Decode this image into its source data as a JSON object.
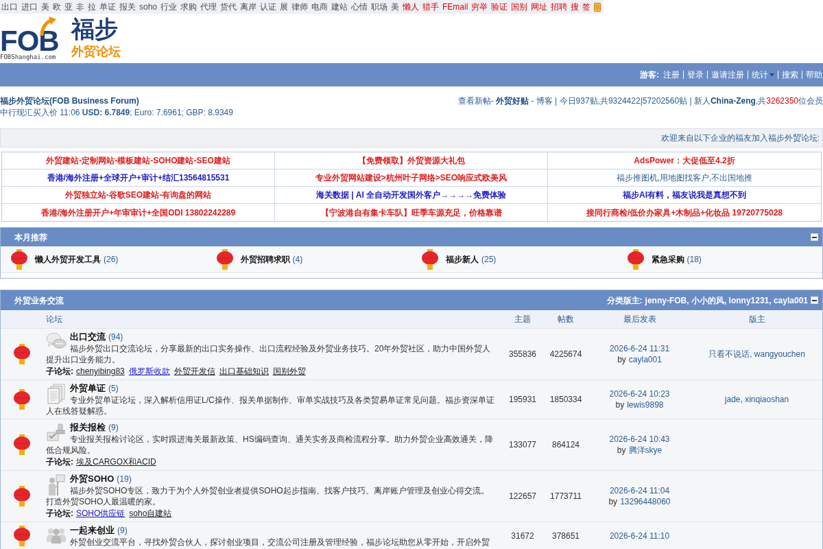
{
  "top_nav": [
    {
      "label": "出口",
      "hot": false
    },
    {
      "label": "进口",
      "hot": false
    },
    {
      "label": "美",
      "hot": false
    },
    {
      "label": "欧",
      "hot": false
    },
    {
      "label": "亚",
      "hot": false
    },
    {
      "label": "非",
      "hot": false
    },
    {
      "label": "拉",
      "hot": false
    },
    {
      "label": "单证",
      "hot": false
    },
    {
      "label": "报关",
      "hot": false
    },
    {
      "label": "soho",
      "hot": false
    },
    {
      "label": "行业",
      "hot": false
    },
    {
      "label": "求购",
      "hot": false
    },
    {
      "label": "代理",
      "hot": false
    },
    {
      "label": "货代",
      "hot": false
    },
    {
      "label": "离岸",
      "hot": false
    },
    {
      "label": "认证",
      "hot": false
    },
    {
      "label": "展",
      "hot": false
    },
    {
      "label": "律师",
      "hot": false
    },
    {
      "label": "电商",
      "hot": false
    },
    {
      "label": "建站",
      "hot": false
    },
    {
      "label": "心情",
      "hot": false
    },
    {
      "label": "职场",
      "hot": false
    },
    {
      "label": "美",
      "hot": false
    },
    {
      "label": "懒人",
      "hot": true
    },
    {
      "label": "猎手",
      "hot": true
    },
    {
      "label": "FEmail",
      "hot": true
    },
    {
      "label": "穷举",
      "hot": true
    },
    {
      "label": "验证",
      "hot": true
    },
    {
      "label": "国别",
      "hot": true
    },
    {
      "label": "网址",
      "hot": true
    },
    {
      "label": "招聘",
      "hot": true
    },
    {
      "label": "搜",
      "hot": true
    },
    {
      "label": "签",
      "hot": true
    }
  ],
  "logo": {
    "wordmark": "FOB",
    "domain": "FOBShanghai.com",
    "name": "福步",
    "tagline": "外贸论坛"
  },
  "user_bar": {
    "label": "游客:",
    "links": [
      {
        "label": "注册",
        "dropdown": false
      },
      {
        "label": "登录",
        "dropdown": false
      },
      {
        "label": "邀请注册",
        "dropdown": false
      },
      {
        "label": "统计",
        "dropdown": true
      },
      {
        "label": "搜索",
        "dropdown": false
      },
      {
        "label": "帮助",
        "dropdown": false
      }
    ]
  },
  "site": {
    "title": "福步外贸论坛(FOB Business Forum)",
    "rates": "中行现汇买入价 11:06 **USD: 6.7849**; Euro: 7.6961; GBP: 8.9349"
  },
  "stats": [
    {
      "text": "查看新帖- ",
      "kind": "text"
    },
    {
      "text": "外贸好贴",
      "kind": "bold"
    },
    {
      "text": " - 博客 | 今日937贴,共9324422|57202560贴 | 新人",
      "kind": "text"
    },
    {
      "text": "China-Zeng",
      "kind": "bold"
    },
    {
      "text": ",共",
      "kind": "text"
    },
    {
      "text": "3262350",
      "kind": "red"
    },
    {
      "text": "位会员",
      "kind": "text"
    }
  ],
  "welcome": "欢迎来自以下企业的福友加入福步外贸论坛:",
  "ads": [
    {
      "text": "外贸建站-定制网站-模板建站-SOHO建站-SEO建站",
      "color": "#e01b1b",
      "bold": true
    },
    {
      "text": "【免费领取】外贸资源大礼包",
      "color": "#e01b1b",
      "bold": true
    },
    {
      "text": "AdsPower：大促低至4.2折",
      "color": "#e01b1b",
      "bold": true
    },
    {
      "text": "香港/海外注册+全球开户+审计+结汇13564815531",
      "color": "#1a1ac8",
      "bold": true
    },
    {
      "text": "专业外贸网站建设>杭州叶子网络>SEO响应式欧美风",
      "color": "#e01b1b",
      "bold": true
    },
    {
      "text": "福步推图机,用地图找客户,不出国地推",
      "color": "#2b5c93",
      "bold": false
    },
    {
      "text": "外贸独立站-谷歌SEO建站-有询盘的网站",
      "color": "#e01b1b",
      "bold": true
    },
    {
      "text": "海关数据 | AI 全自动开发国外客户→→→→免费体验",
      "color": "#1a1ac8",
      "bold": true
    },
    {
      "text": "福步AI有料，福友说我是真想不到",
      "color": "#1a1ac8",
      "bold": true
    },
    {
      "text": "香港/海外注册开户+年审审计+全国ODI 13802242289",
      "color": "#e01b1b",
      "bold": true
    },
    {
      "text": "【宁波港自有集卡车队】旺季车源充足，价格靠谱",
      "color": "#e01b1b",
      "bold": true
    },
    {
      "text": "接同行商检/低价办家具+木制品+化妆品 19720775028",
      "color": "#e01b1b",
      "bold": true
    }
  ],
  "monthly": {
    "title": "本月推荐",
    "items": [
      {
        "name": "懒人外贸开发工具",
        "count": "(26)"
      },
      {
        "name": "外贸招聘求职",
        "count": "(4)"
      },
      {
        "name": "福步新人",
        "count": "(25)"
      },
      {
        "name": "紧急采购",
        "count": "(18)"
      }
    ]
  },
  "category": {
    "title": "外贸业务交流",
    "moderators_label": "分类版主:",
    "moderators": "jenny-FOB, 小小的风, lonny1231, cayla001",
    "columns": [
      "论坛",
      "主题",
      "帖数",
      "最后发表",
      "版主"
    ],
    "forums": [
      {
        "name": "出口交流",
        "count": "(94)",
        "description": "福步外贸出口交流论坛，分享最新的出口实务操作、出口流程经验及外贸业务技巧。20年外贸社区，助力中国外贸人提升出口业务能力。",
        "subforums_label": "子论坛:",
        "subforums": [
          {
            "name": "chenyibing83",
            "color": "#222222"
          },
          {
            "name": "俄罗斯收款",
            "color": "#2020cc"
          },
          {
            "name": "外贸开发信",
            "color": "#222222"
          },
          {
            "name": "出口基础知识",
            "color": "#222222"
          },
          {
            "name": "国别外贸",
            "color": "#222222"
          }
        ],
        "topics": "355836",
        "posts": "4225674",
        "last_post": {
          "date": "2026-6-24 11:31",
          "by": "by",
          "author": "cayla001"
        },
        "moderators": "只看不说话, wangyouchen"
      },
      {
        "name": "外贸单证",
        "count": "(5)",
        "description": "专业外贸单证论坛，深入解析信用证L/C操作、报关单据制作、审单实战技巧及各类贸易单证常见问题。福步资深单证人在线答疑解惑。",
        "topics": "195931",
        "posts": "1850334",
        "last_post": {
          "date": "2026-6-24 10:23",
          "by": "by",
          "author": "lewis9898"
        },
        "moderators": "jade, xinqiaoshan"
      },
      {
        "name": "报关报检",
        "count": "(9)",
        "description": "专业报关报检讨论区，实时跟进海关最新政策、HS编码查询、通关实务及商检流程分享。助力外贸企业高效通关，降低合规风险。",
        "subforums_label": "子论坛:",
        "subforums": [
          {
            "name": "埃及CARGOX和ACID",
            "color": "#222222"
          }
        ],
        "topics": "133077",
        "posts": "864124",
        "last_post": {
          "date": "2026-6-24 10:43",
          "by": "by",
          "author": "腾洋skye"
        }
      },
      {
        "name": "外贸SOHO",
        "count": "(19)",
        "description": "福步外贸SOHO专区，致力于为个人外贸创业者提供SOHO起步指南、找客户技巧、离岸账户管理及创业心得交流。打造外贸SOHO人最温暖的家。",
        "subforums_label": "子论坛:",
        "subforums": [
          {
            "name": "SOHO供应链",
            "color": "#2020cc"
          },
          {
            "name": "soho自建站",
            "color": "#222222"
          }
        ],
        "topics": "122657",
        "posts": "1773711",
        "last_post": {
          "date": "2026-6-24 11:04",
          "by": "by",
          "author": "13296448060"
        }
      },
      {
        "name": "一起来创业",
        "count": "(9)",
        "description": "外贸创业交流平台，寻找外贸合伙人，探讨创业项目，交流公司注册及管理经验，福步论坛助您从零开始，开启外贸",
        "topics": "31672",
        "posts": "378651",
        "last_post": {
          "date": "2026-6-24 11:10"
        }
      }
    ]
  }
}
